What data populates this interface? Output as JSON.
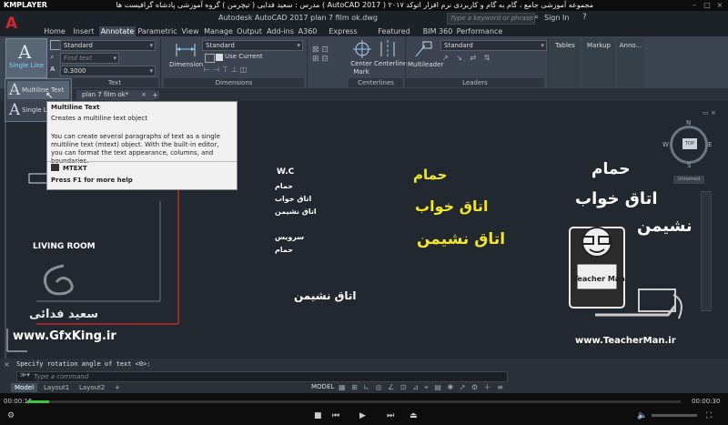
{
  "kmplayer": {
    "logo": "KMPLAYER",
    "title": "مجموعه آموزشی جامع ، گام به گام و کاربردی نرم افزار   اتوکد ۲۰۱۷  ( AutoCAD 2017 )   مدرس : سعید فدایی ( تیچرمن ) گروه آموزشی پادشاه گرافیست ها"
  },
  "acad": {
    "doc_title": "Autodesk AutoCAD 2017    plan 7 film ok.dwg",
    "search_placeholder": "Type a keyword or phrase",
    "signin": "Sign In",
    "tabs": [
      "Home",
      "Insert",
      "Annotate",
      "Parametric",
      "View",
      "Manage",
      "Output",
      "Add-ins",
      "A360",
      "Express Tools",
      "Featured Apps",
      "BIM 360",
      "Performance"
    ],
    "active_tab": "Annotate"
  },
  "ribbon": {
    "text_panel": {
      "single_line_label": "Single Line",
      "style_value": "Standard",
      "find_placeholder": "Find text",
      "height_value": "0.3000",
      "panel_title": "Text"
    },
    "dimensions_panel": {
      "dimension_label": "Dimension",
      "style_value": "Standard",
      "layer_value": "Use Current",
      "panel_title": "Dimensions"
    },
    "centerlines_panel": {
      "center_mark_label": "Center Mark",
      "centerline_label": "Centerline",
      "panel_title": "Centerlines"
    },
    "leaders_panel": {
      "multileader_label": "Multileader",
      "style_value": "Standard",
      "panel_title": "Leaders"
    },
    "tables_label": "Tables",
    "markup_label": "Markup",
    "anno_label": "Anno..."
  },
  "gallery": {
    "items": [
      "Multiline Text",
      "Single Line"
    ]
  },
  "doc_tab": "plan 7 film ok*",
  "tooltip": {
    "title": "Multiline Text",
    "short": "Creates a multiline text object",
    "long": "You can create several paragraphs of text as a single multiline text (mtext) object. With the built-in editor, you can format the text appearance, columns, and boundaries.",
    "command": "MTEXT",
    "help": "Press F1 for more help"
  },
  "viewcube": {
    "top": "TOP",
    "north": "N",
    "south": "S",
    "east": "E",
    "west": "W",
    "ucs": "Unnamed"
  },
  "drawing": {
    "small_white": [
      "W.C",
      "حمام",
      "اتاق خواب",
      "اتاق نشیمن",
      "سرویس",
      "حمام"
    ],
    "living_room": "LIVING ROOM",
    "center_white": "اتاق نشیمن",
    "yellow": [
      "حمام",
      "اتاق خواب",
      "اتاق نشیمن"
    ],
    "big_white": [
      "حمام",
      "اتاق خواب",
      "نشیمن"
    ],
    "gfxking": "www.GfxKing.ir",
    "teacherman": "www.TeacherMan.ir",
    "teacherman_logo": "Teacher Man",
    "signature": "سعید فدائی"
  },
  "cmdline": {
    "history": "Specify rotation angle of text <0>:",
    "input_placeholder": "Type a command"
  },
  "status": {
    "layout_tabs": [
      "Model",
      "Layout1",
      "Layout2"
    ],
    "active_layout": "Model",
    "model_label": "MODEL"
  },
  "player": {
    "current": "00:00:16",
    "total": "00:00:30",
    "progress_fraction": 0.033
  },
  "colors": {
    "accent_red": "#d3262d",
    "yellow_text": "#f2e52a",
    "progress_green": "#3ec13e"
  }
}
